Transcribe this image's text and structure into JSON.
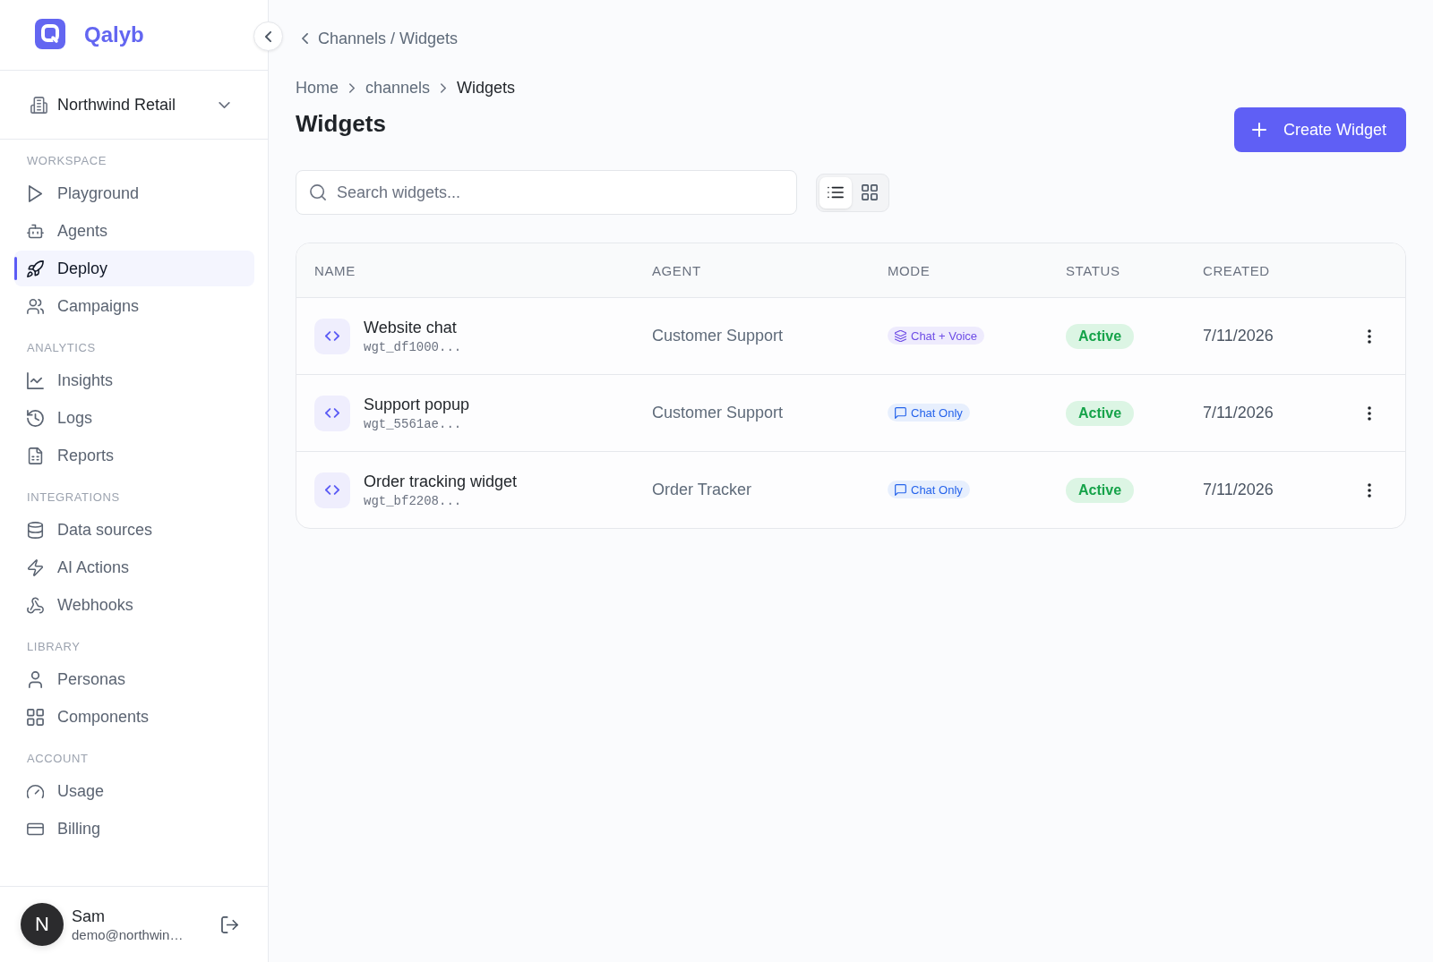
{
  "sidebar": {
    "brand": "Qalyb",
    "workspace": "Northwind Retail",
    "sections": [
      {
        "title": "WORKSPACE",
        "items": [
          {
            "label": "Playground",
            "selected": false
          },
          {
            "label": "Agents",
            "selected": false
          },
          {
            "label": "Deploy",
            "selected": true
          },
          {
            "label": "Campaigns",
            "selected": false
          }
        ]
      },
      {
        "title": "ANALYTICS",
        "items": [
          {
            "label": "Insights",
            "selected": false
          },
          {
            "label": "Logs",
            "selected": false
          },
          {
            "label": "Reports",
            "selected": false
          }
        ]
      },
      {
        "title": "INTEGRATIONS",
        "items": [
          {
            "label": "Data sources",
            "selected": false
          },
          {
            "label": "AI Actions",
            "selected": false
          },
          {
            "label": "Webhooks",
            "selected": false
          }
        ]
      },
      {
        "title": "LIBRARY",
        "items": [
          {
            "label": "Personas",
            "selected": false
          },
          {
            "label": "Components",
            "selected": false
          }
        ]
      },
      {
        "title": "ACCOUNT",
        "items": [
          {
            "label": "Usage",
            "selected": false
          },
          {
            "label": "Billing",
            "selected": false
          }
        ]
      }
    ],
    "user": {
      "initial": "N",
      "name": "Sam",
      "email": "demo@northwin…"
    }
  },
  "back_link": "Channels / Widgets",
  "breadcrumb": [
    {
      "label": "Home",
      "current": false
    },
    {
      "label": "channels",
      "current": false
    },
    {
      "label": "Widgets",
      "current": true
    }
  ],
  "title": "Widgets",
  "create_button": "Create Widget",
  "search": {
    "placeholder": "Search widgets..."
  },
  "view_toggle": [
    {
      "kind": "list",
      "selected": true
    },
    {
      "kind": "grid",
      "selected": false
    }
  ],
  "table": {
    "columns": [
      "NAME",
      "AGENT",
      "MODE",
      "STATUS",
      "CREATED"
    ],
    "rows": [
      {
        "name": "Website chat",
        "id": "wgt_df1000...",
        "agent": "Customer Support",
        "mode": {
          "kind": "chat_voice",
          "label": "Chat + Voice"
        },
        "status": {
          "kind": "active",
          "label": "Active"
        },
        "created": "7/11/2026"
      },
      {
        "name": "Support popup",
        "id": "wgt_5561ae...",
        "agent": "Customer Support",
        "mode": {
          "kind": "chat",
          "label": "Chat Only"
        },
        "status": {
          "kind": "active",
          "label": "Active"
        },
        "created": "7/11/2026"
      },
      {
        "name": "Order tracking widget",
        "id": "wgt_bf2208...",
        "agent": "Order Tracker",
        "mode": {
          "kind": "chat",
          "label": "Chat Only"
        },
        "status": {
          "kind": "active",
          "label": "Active"
        },
        "created": "7/11/2026"
      }
    ]
  }
}
